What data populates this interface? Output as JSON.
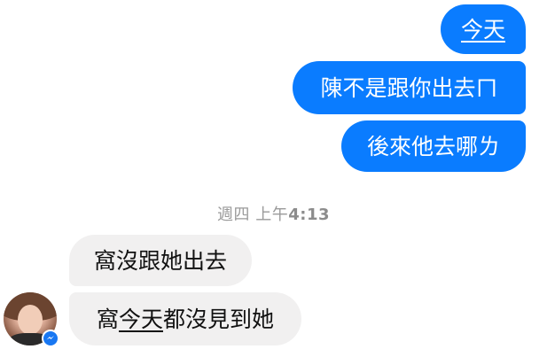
{
  "conversation": {
    "sent_messages": [
      {
        "text": "今天"
      },
      {
        "text": "陳不是跟你出去ㄇ"
      },
      {
        "text": "後來他去哪ㄌ"
      }
    ],
    "timestamp": {
      "day": "週四",
      "period": "上午",
      "time": "4:13"
    },
    "received_messages": [
      {
        "text": "窩沒跟她出去"
      },
      {
        "prefix": "窩",
        "link": "今天",
        "suffix": "都沒見到她"
      }
    ]
  },
  "contact": {
    "avatar": "profile-photo",
    "badge_icon": "messenger-icon"
  },
  "colors": {
    "sent_bubble": "#0a7cff",
    "received_bubble": "#f1f0f0",
    "timestamp_text": "#9a9a9a",
    "messenger_badge": "#1877f2"
  }
}
